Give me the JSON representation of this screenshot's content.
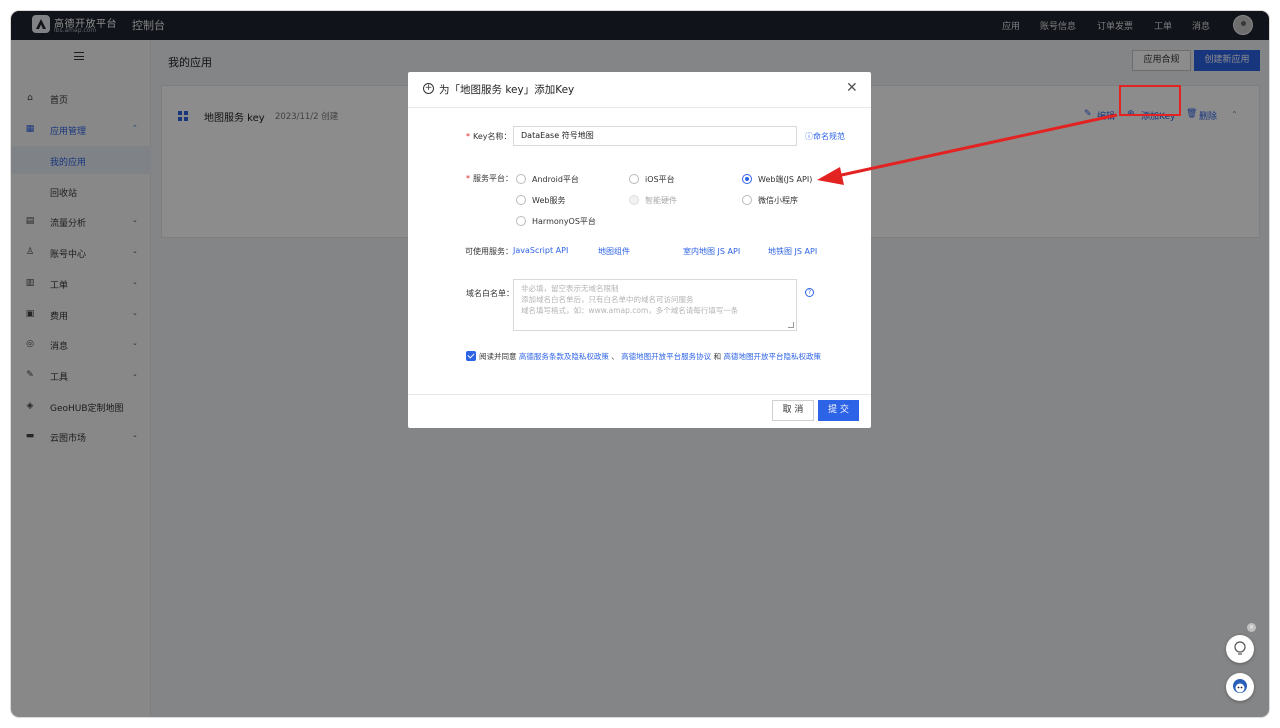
{
  "topbar": {
    "logo_text": "高德开放平台",
    "logo_sub": "lbs.amap.com",
    "console": "控制台",
    "nav": [
      "应用",
      "账号信息",
      "订单发票",
      "工单",
      "消息"
    ]
  },
  "sidebar": {
    "items": [
      {
        "icon": "home-icon",
        "label": "首页"
      },
      {
        "icon": "app-grid-icon",
        "label": "应用管理"
      },
      {
        "label": "我的应用"
      },
      {
        "label": "回收站"
      },
      {
        "icon": "chart-icon",
        "label": "流量分析"
      },
      {
        "icon": "user-icon",
        "label": "账号中心"
      },
      {
        "icon": "ticket-icon",
        "label": "工单"
      },
      {
        "icon": "fee-icon",
        "label": "费用"
      },
      {
        "icon": "message-icon",
        "label": "消息"
      },
      {
        "icon": "wrench-icon",
        "label": "工具"
      },
      {
        "icon": "layers-icon",
        "label": "GeoHUB定制地图"
      },
      {
        "icon": "store-icon",
        "label": "云图市场"
      }
    ]
  },
  "main": {
    "title": "我的应用",
    "compliance_button": "应用合规",
    "create_button": "创建新应用",
    "app": {
      "name": "地图服务 key",
      "created": "2023/11/2 创建",
      "edit": "编辑",
      "add_key": "添加Key",
      "delete": "删除"
    }
  },
  "modal": {
    "title": "为「地图服务 key」添加Key",
    "key_name_label": "Key名称：",
    "key_name_value": "DataEase 符号地图",
    "naming_rule_link": "命名规范",
    "platform_label": "服务平台：",
    "platforms": [
      {
        "label": "Android平台",
        "selected": false,
        "disabled": false
      },
      {
        "label": "iOS平台",
        "selected": false,
        "disabled": false
      },
      {
        "label": "Web端(JS API)",
        "selected": true,
        "disabled": false
      },
      {
        "label": "Web服务",
        "selected": false,
        "disabled": false
      },
      {
        "label": "智能硬件",
        "selected": false,
        "disabled": true
      },
      {
        "label": "微信小程序",
        "selected": false,
        "disabled": false
      },
      {
        "label": "HarmonyOS平台",
        "selected": false,
        "disabled": false
      }
    ],
    "services_label": "可使用服务：",
    "services": [
      "JavaScript API",
      "地图组件",
      "室内地图 JS API",
      "地铁图 JS API"
    ],
    "whitelist_label": "域名白名单：",
    "whitelist_placeholder": [
      "非必填，留空表示无域名限制",
      "添加域名白名单后，只有白名单中的域名可访问服务",
      "域名填写格式，如：www.amap.com，多个域名请每行填写一条"
    ],
    "agree_prefix": "阅读并同意",
    "agree_link1": "高德服务条款及隐私权政策",
    "agree_sep1": "、",
    "agree_link2": "高德地图开放平台服务协议",
    "agree_sep2": "和",
    "agree_link3": "高德地图开放平台隐私权政策",
    "cancel": "取 消",
    "submit": "提 交"
  },
  "colors": {
    "accent": "#2d63e6",
    "annotation": "#e32222",
    "topbar": "#1f2430"
  }
}
